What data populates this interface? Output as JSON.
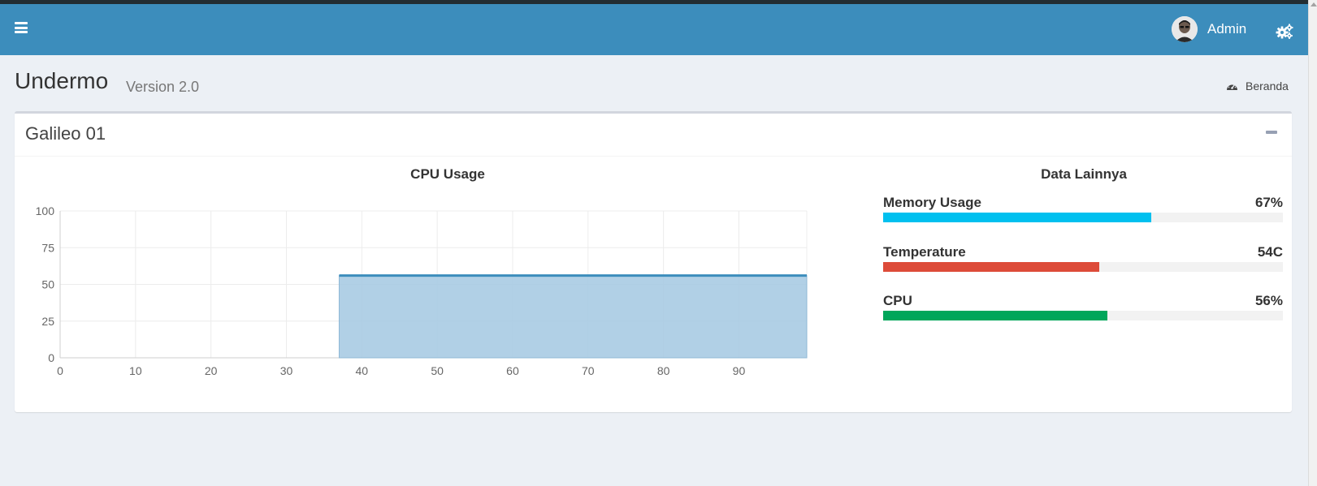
{
  "header": {
    "user_name": "Admin",
    "icons": {
      "menu": "hamburger-icon",
      "avatar": "user-avatar",
      "settings": "gears-icon"
    }
  },
  "page": {
    "title": "Undermo",
    "version": "Version 2.0"
  },
  "breadcrumb": {
    "label": "Beranda",
    "icon": "dashboard-icon"
  },
  "box": {
    "title": "Galileo 01",
    "collapse_icon": "minus-icon"
  },
  "chart_data": {
    "type": "area",
    "title": "CPU Usage",
    "xlim": [
      0,
      99
    ],
    "ylim": [
      0,
      100
    ],
    "x_ticks": [
      0,
      10,
      20,
      30,
      40,
      50,
      60,
      70,
      80,
      90
    ],
    "y_ticks": [
      0,
      25,
      50,
      75,
      100
    ],
    "series": [
      {
        "x": [
          37,
          99
        ],
        "y": [
          56,
          56
        ]
      }
    ],
    "grid": true,
    "colors": {
      "line": "#3c8dbc",
      "fill": "#a8cbe3"
    }
  },
  "side": {
    "title": "Data Lainnya",
    "items": [
      {
        "label": "Memory Usage",
        "value": "67%",
        "fraction": 0.67,
        "color": "#00c0ef"
      },
      {
        "label": "Temperature",
        "value": "54C",
        "fraction": 0.54,
        "color": "#dd4b39"
      },
      {
        "label": "CPU",
        "value": "56%",
        "fraction": 0.56,
        "color": "#00a65a"
      }
    ]
  }
}
